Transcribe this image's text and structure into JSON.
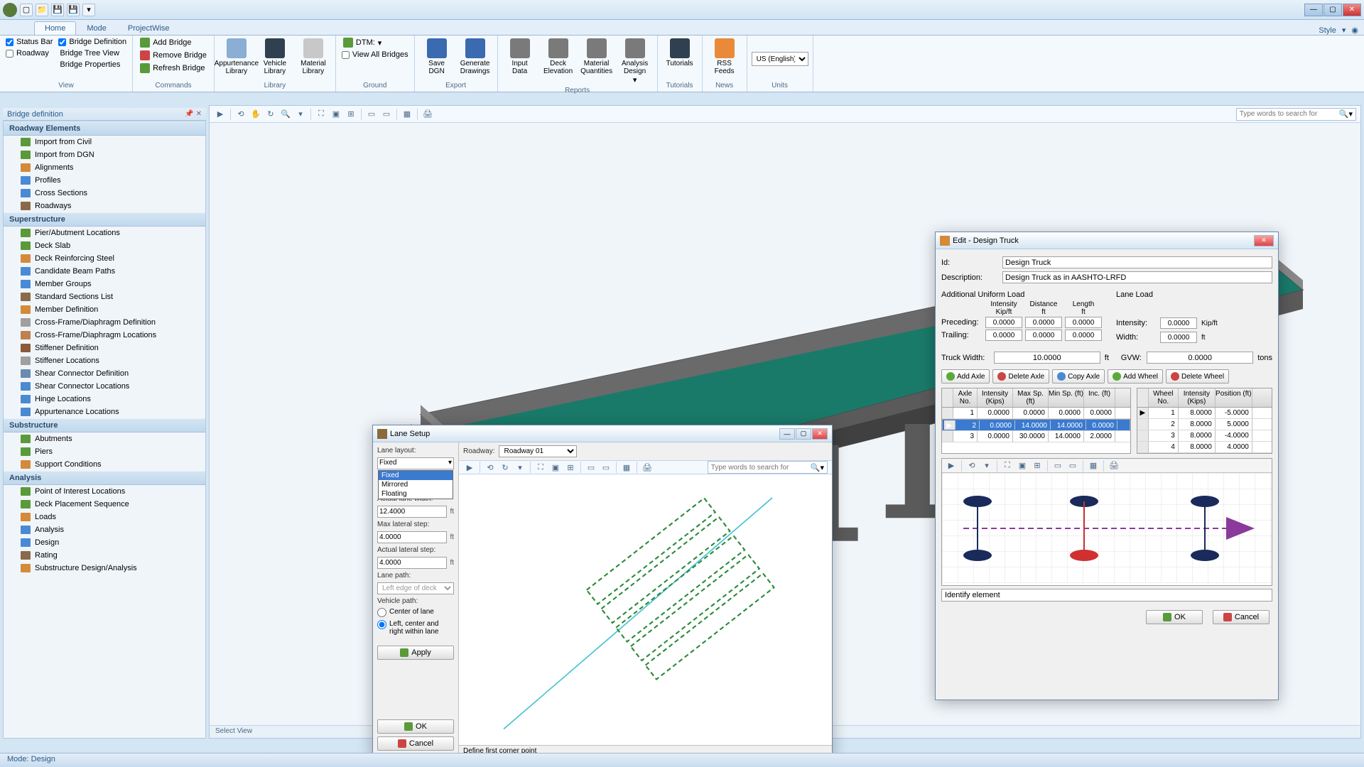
{
  "titleBar": {
    "qat": [
      "new",
      "open",
      "save",
      "save-all",
      "dropdown"
    ]
  },
  "ribbonTabs": [
    "Home",
    "Mode",
    "ProjectWise"
  ],
  "ribbonRight": {
    "style": "Style"
  },
  "ribbon": {
    "view": {
      "label": "View",
      "items": [
        "Status Bar",
        "Roadway"
      ],
      "items2": [
        "Bridge Definition",
        "Bridge Tree View",
        "Bridge Properties"
      ]
    },
    "commands": {
      "label": "Commands",
      "addBridge": "Add Bridge",
      "removeBridge": "Remove Bridge",
      "refreshBridge": "Refresh Bridge"
    },
    "library": {
      "label": "Library",
      "app": "Appurtenance Library",
      "veh": "Vehicle Library",
      "mat": "Material Library"
    },
    "ground": {
      "label": "Ground",
      "dtm": "DTM:",
      "viewAll": "View All Bridges"
    },
    "export": {
      "label": "Export",
      "save": "Save DGN",
      "gen": "Generate Drawings"
    },
    "reports": {
      "label": "Reports",
      "input": "Input Data",
      "deck": "Deck Elevation",
      "mat": "Material Quantities",
      "analysis": "Analysis Design"
    },
    "tutorials": {
      "label": "Tutorials",
      "btn": "Tutorials"
    },
    "news": {
      "label": "News",
      "btn": "RSS Feeds"
    },
    "units": {
      "label": "Units",
      "val": "US (English)"
    }
  },
  "sidebarTitle": "Bridge definition",
  "sidebar": {
    "roadway": {
      "header": "Roadway Elements",
      "items": [
        "Import from Civil",
        "Import from DGN",
        "Alignments",
        "Profiles",
        "Cross Sections",
        "Roadways"
      ]
    },
    "super": {
      "header": "Superstructure",
      "items": [
        "Pier/Abutment Locations",
        "Deck Slab",
        "Deck Reinforcing Steel",
        "Candidate Beam Paths",
        "Member Groups",
        "Standard Sections List",
        "Member Definition",
        "Cross-Frame/Diaphragm Definition",
        "Cross-Frame/Diaphragm Locations",
        "Stiffener Definition",
        "Stiffener Locations",
        "Shear Connector Definition",
        "Shear Connector Locations",
        "Hinge Locations",
        "Appurtenance Locations"
      ]
    },
    "sub": {
      "header": "Substructure",
      "items": [
        "Abutments",
        "Piers",
        "Support Conditions"
      ]
    },
    "analysis": {
      "header": "Analysis",
      "items": [
        "Point of Interest Locations",
        "Deck Placement Sequence",
        "Loads",
        "Analysis",
        "Design",
        "Rating",
        "Substructure Design/Analysis"
      ]
    }
  },
  "searchPlaceholder": "Type words to search for",
  "viewFooter": "Select View",
  "statusBar": "Mode: Design",
  "laneDlg": {
    "title": "Lane Setup",
    "laneLayout": "Lane layout:",
    "layoutVal": "Fixed",
    "layoutOptions": [
      "Fixed",
      "Mirrored",
      "Floating"
    ],
    "roadway": "Roadway:",
    "roadwayVal": "Roadway 01",
    "actualLaneWidth": "Actual lane width:",
    "actualLaneWidthVal": "12.4000",
    "maxLateralStep": "Max lateral step:",
    "maxLateralStepVal": "4.0000",
    "actualLateralStep": "Actual lateral step:",
    "actualLateralStepVal": "4.0000",
    "lanePath": "Lane path:",
    "lanePathVal": "Left edge of deck",
    "vehiclePath": "Vehicle path:",
    "vpOpt1": "Center of lane",
    "vpOpt2": "Left, center and right within lane",
    "apply": "Apply",
    "ok": "OK",
    "cancel": "Cancel",
    "footer": "Define first corner point",
    "ft": "ft"
  },
  "truckDlg": {
    "title": "Edit - Design Truck",
    "id": "Id:",
    "idVal": "Design Truck",
    "desc": "Description:",
    "descVal": "Design Truck as in AASHTO-LRFD",
    "addUniform": "Additional Uniform Load",
    "laneLoad": "Lane Load",
    "intensity": "Intensity",
    "distance": "Distance",
    "length": "Length",
    "kipft": "Kip/ft",
    "ft": "ft",
    "tons": "tons",
    "preceding": "Preceding:",
    "trailing": "Trailing:",
    "preRow": [
      "0.0000",
      "0.0000",
      "0.0000"
    ],
    "trailRow": [
      "0.0000",
      "0.0000",
      "0.0000"
    ],
    "intensityL": "Intensity:",
    "intensityVal": "0.0000",
    "width": "Width:",
    "widthVal": "0.0000",
    "truckWidth": "Truck Width:",
    "truckWidthVal": "10.0000",
    "gvw": "GVW:",
    "gvwVal": "0.0000",
    "addAxle": "Add Axle",
    "delAxle": "Delete Axle",
    "copyAxle": "Copy Axle",
    "addWheel": "Add Wheel",
    "delWheel": "Delete Wheel",
    "axleHdrs": [
      "Axle No.",
      "Intensity (Kips)",
      "Max Sp. (ft)",
      "Min Sp. (ft)",
      "Inc. (ft)"
    ],
    "axleRows": [
      [
        "1",
        "0.0000",
        "0.0000",
        "0.0000",
        "0.0000"
      ],
      [
        "2",
        "0.0000",
        "14.0000",
        "14.0000",
        "0.0000"
      ],
      [
        "3",
        "0.0000",
        "30.0000",
        "14.0000",
        "2.0000"
      ]
    ],
    "axleSelRow": 1,
    "wheelHdrs": [
      "Wheel No.",
      "Intensity (Kips)",
      "Position (ft)"
    ],
    "wheelRows": [
      [
        "1",
        "8.0000",
        "-5.0000"
      ],
      [
        "2",
        "8.0000",
        "5.0000"
      ],
      [
        "3",
        "8.0000",
        "-4.0000"
      ],
      [
        "4",
        "8.0000",
        "4.0000"
      ]
    ],
    "identify": "Identify element",
    "ok": "OK",
    "cancel": "Cancel"
  }
}
